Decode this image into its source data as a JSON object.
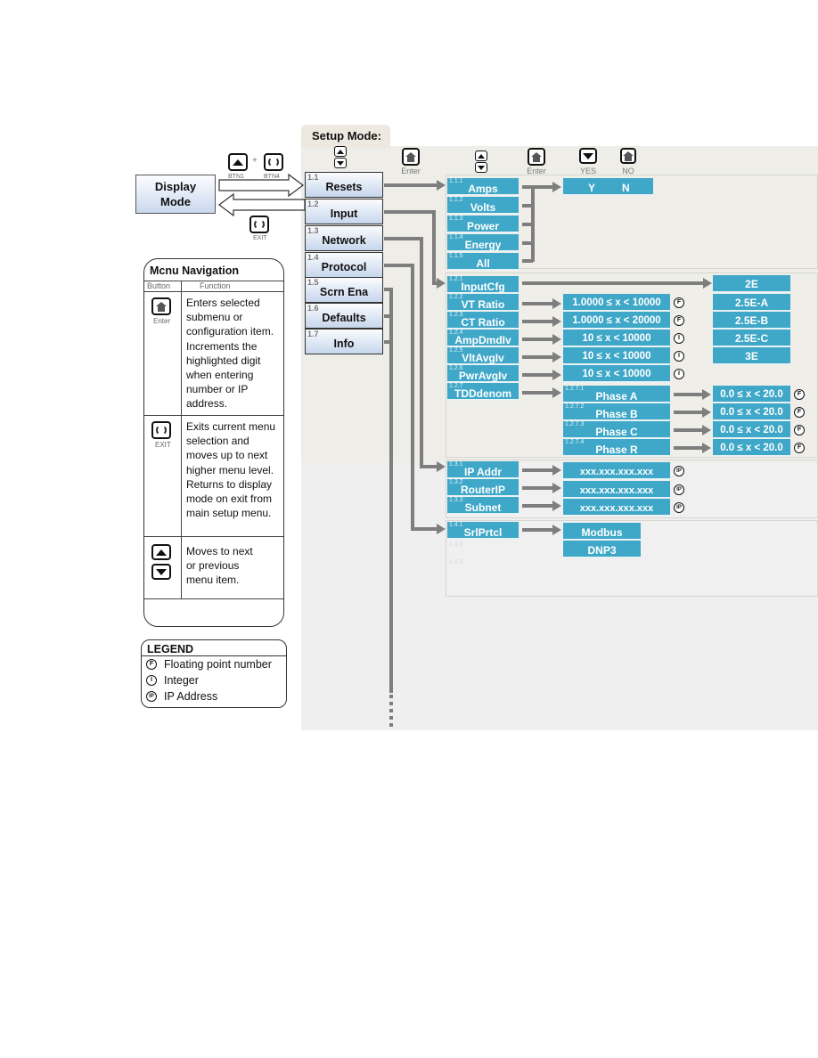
{
  "setup_mode": {
    "title": "Setup Mode:",
    "header_icons": [
      {
        "icon": "up-down-arrows-icon",
        "caption": ""
      },
      {
        "icon": "enter-home-icon",
        "caption": "Enter"
      },
      {
        "icon": "up-down-arrows-icon",
        "caption": ""
      },
      {
        "icon": "enter-home-icon",
        "caption": "Enter"
      },
      {
        "icon": "down-arrow-icon",
        "caption": "YES"
      },
      {
        "icon": "enter-home-icon",
        "caption": "NO"
      }
    ]
  },
  "display_mode": {
    "label_line1": "Display",
    "label_line2": "Mode",
    "enter_combo": {
      "btn1_label": "BTN1",
      "plus": "+",
      "btn4_label": "BTN4"
    },
    "exit_label": "EXIT"
  },
  "main_menu": [
    {
      "num": "1.1",
      "label": "Resets"
    },
    {
      "num": "1.2",
      "label": "Input"
    },
    {
      "num": "1.3",
      "label": "Network"
    },
    {
      "num": "1.4",
      "label": "Protocol"
    },
    {
      "num": "1.5",
      "label": "Scrn Ena"
    },
    {
      "num": "1.6",
      "label": "Defaults"
    },
    {
      "num": "1.7",
      "label": "Info"
    }
  ],
  "resets": {
    "items": [
      {
        "num": "1.1.1",
        "label": "Amps"
      },
      {
        "num": "1.1.2",
        "label": "Volts"
      },
      {
        "num": "1.1.3",
        "label": "Power"
      },
      {
        "num": "1.1.4",
        "label": "Energy"
      },
      {
        "num": "1.1.5",
        "label": "All"
      }
    ],
    "confirm": {
      "yes": "Y",
      "no": "N"
    }
  },
  "input": {
    "items": [
      {
        "num": "1.2.1",
        "label": "InputCfg",
        "range": "",
        "type": ""
      },
      {
        "num": "1.2.2",
        "label": "VT Ratio",
        "range": "1.0000 ≤ x < 10000",
        "type": "F"
      },
      {
        "num": "1.2.3",
        "label": "CT Ratio",
        "range": "1.0000 ≤ x < 20000",
        "type": "F"
      },
      {
        "num": "1.2.4",
        "label": "AmpDmdIv",
        "range": "10 ≤ x < 10000",
        "type": "I"
      },
      {
        "num": "1.2.5",
        "label": "VltAvgIv",
        "range": "10 ≤ x < 10000",
        "type": "I"
      },
      {
        "num": "1.2.6",
        "label": "PwrAvgIv",
        "range": "10 ≤ x < 10000",
        "type": "I"
      },
      {
        "num": "1.2.7",
        "label": "TDDdenom",
        "range": "",
        "type": ""
      }
    ],
    "input_cfg_options": [
      "2E",
      "2.5E-A",
      "2.5E-B",
      "2.5E-C",
      "3E"
    ],
    "tdd_phases": [
      {
        "num": "1.2.7.1",
        "label": "Phase A",
        "range": "0.0 ≤ x < 20.0",
        "type": "F"
      },
      {
        "num": "1.2.7.2",
        "label": "Phase B",
        "range": "0.0 ≤ x < 20.0",
        "type": "F"
      },
      {
        "num": "1.2.7.3",
        "label": "Phase C",
        "range": "0.0 ≤ x < 20.0",
        "type": "F"
      },
      {
        "num": "1.2.7.4",
        "label": "Phase R",
        "range": "0.0 ≤ x < 20.0",
        "type": "F"
      }
    ]
  },
  "network": {
    "items": [
      {
        "num": "1.3.1",
        "label": "IP Addr",
        "value": "xxx.xxx.xxx.xxx",
        "type": "IP"
      },
      {
        "num": "1.3.2",
        "label": "RouterIP",
        "value": "xxx.xxx.xxx.xxx",
        "type": "IP"
      },
      {
        "num": "1.3.3",
        "label": "Subnet",
        "value": "xxx.xxx.xxx.xxx",
        "type": "IP"
      }
    ]
  },
  "protocol": {
    "items": [
      {
        "num": "1.4.1",
        "label": "SrlPrtcl"
      }
    ],
    "faint_nums": [
      "1.4.2",
      "1.4.3"
    ],
    "options": [
      "Modbus",
      "DNP3"
    ]
  },
  "menu_navigation": {
    "title": "Mcnu Navigation",
    "col_button": "Button",
    "col_function": "Function",
    "rows": [
      {
        "icon": "enter-home-icon",
        "caption": "Enter",
        "lines": [
          "Enters selected",
          "submenu or",
          "configuration item.",
          "Increments the",
          "highlighted digit",
          "when entering",
          "number or IP",
          "address."
        ]
      },
      {
        "icon": "exit-cycle-icon",
        "caption": "EXIT",
        "lines": [
          "Exits current menu",
          "selection and",
          "moves up to next",
          "higher menu level.",
          "Returns to display",
          "mode on exit from",
          "main setup menu."
        ]
      },
      {
        "icon": "up-down-arrows-icon",
        "caption": "",
        "lines": [
          "Moves to next",
          "or previous",
          "menu item."
        ]
      }
    ]
  },
  "legend": {
    "title": "LEGEND",
    "items": [
      {
        "mark": "F",
        "label": "Floating point number"
      },
      {
        "mark": "I",
        "label": "Integer"
      },
      {
        "mark": "IP",
        "label": "IP Address"
      }
    ]
  }
}
